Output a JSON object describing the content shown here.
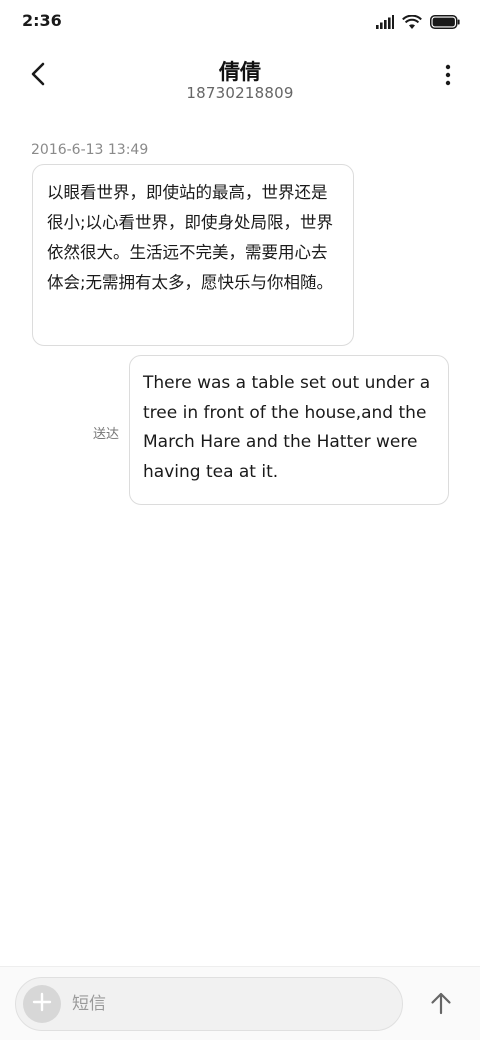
{
  "status_bar": {
    "time": "2:36",
    "icons": [
      "signal-icon",
      "wifi-icon",
      "battery-icon"
    ]
  },
  "header": {
    "contact_name": "倩倩",
    "phone_number": "18730218809",
    "back_icon": "chevron-left-icon",
    "more_icon": "more-vertical-icon"
  },
  "conversation": {
    "timestamp": "2016-6-13 13:49",
    "messages": [
      {
        "direction": "incoming",
        "text": "以眼看世界，即使站的最高，世界还是很小;以心看世界，即使身处局限，世界依然很大。生活远不完美，需要用心去体会;无需拥有太多，愿快乐与你相随。"
      },
      {
        "direction": "outgoing",
        "text": "There was a table set out under a tree in front of the house,and the March Hare and the Hatter were having tea at it.",
        "status": "送达"
      }
    ]
  },
  "composer": {
    "placeholder": "短信",
    "value": "",
    "add_icon": "plus-icon",
    "send_icon": "arrow-up-icon"
  },
  "colors": {
    "background": "#ffffff",
    "bubble_border": "#dcdcdc",
    "secondary_text": "#8a8a8a",
    "composer_field": "#f1f1f1"
  }
}
